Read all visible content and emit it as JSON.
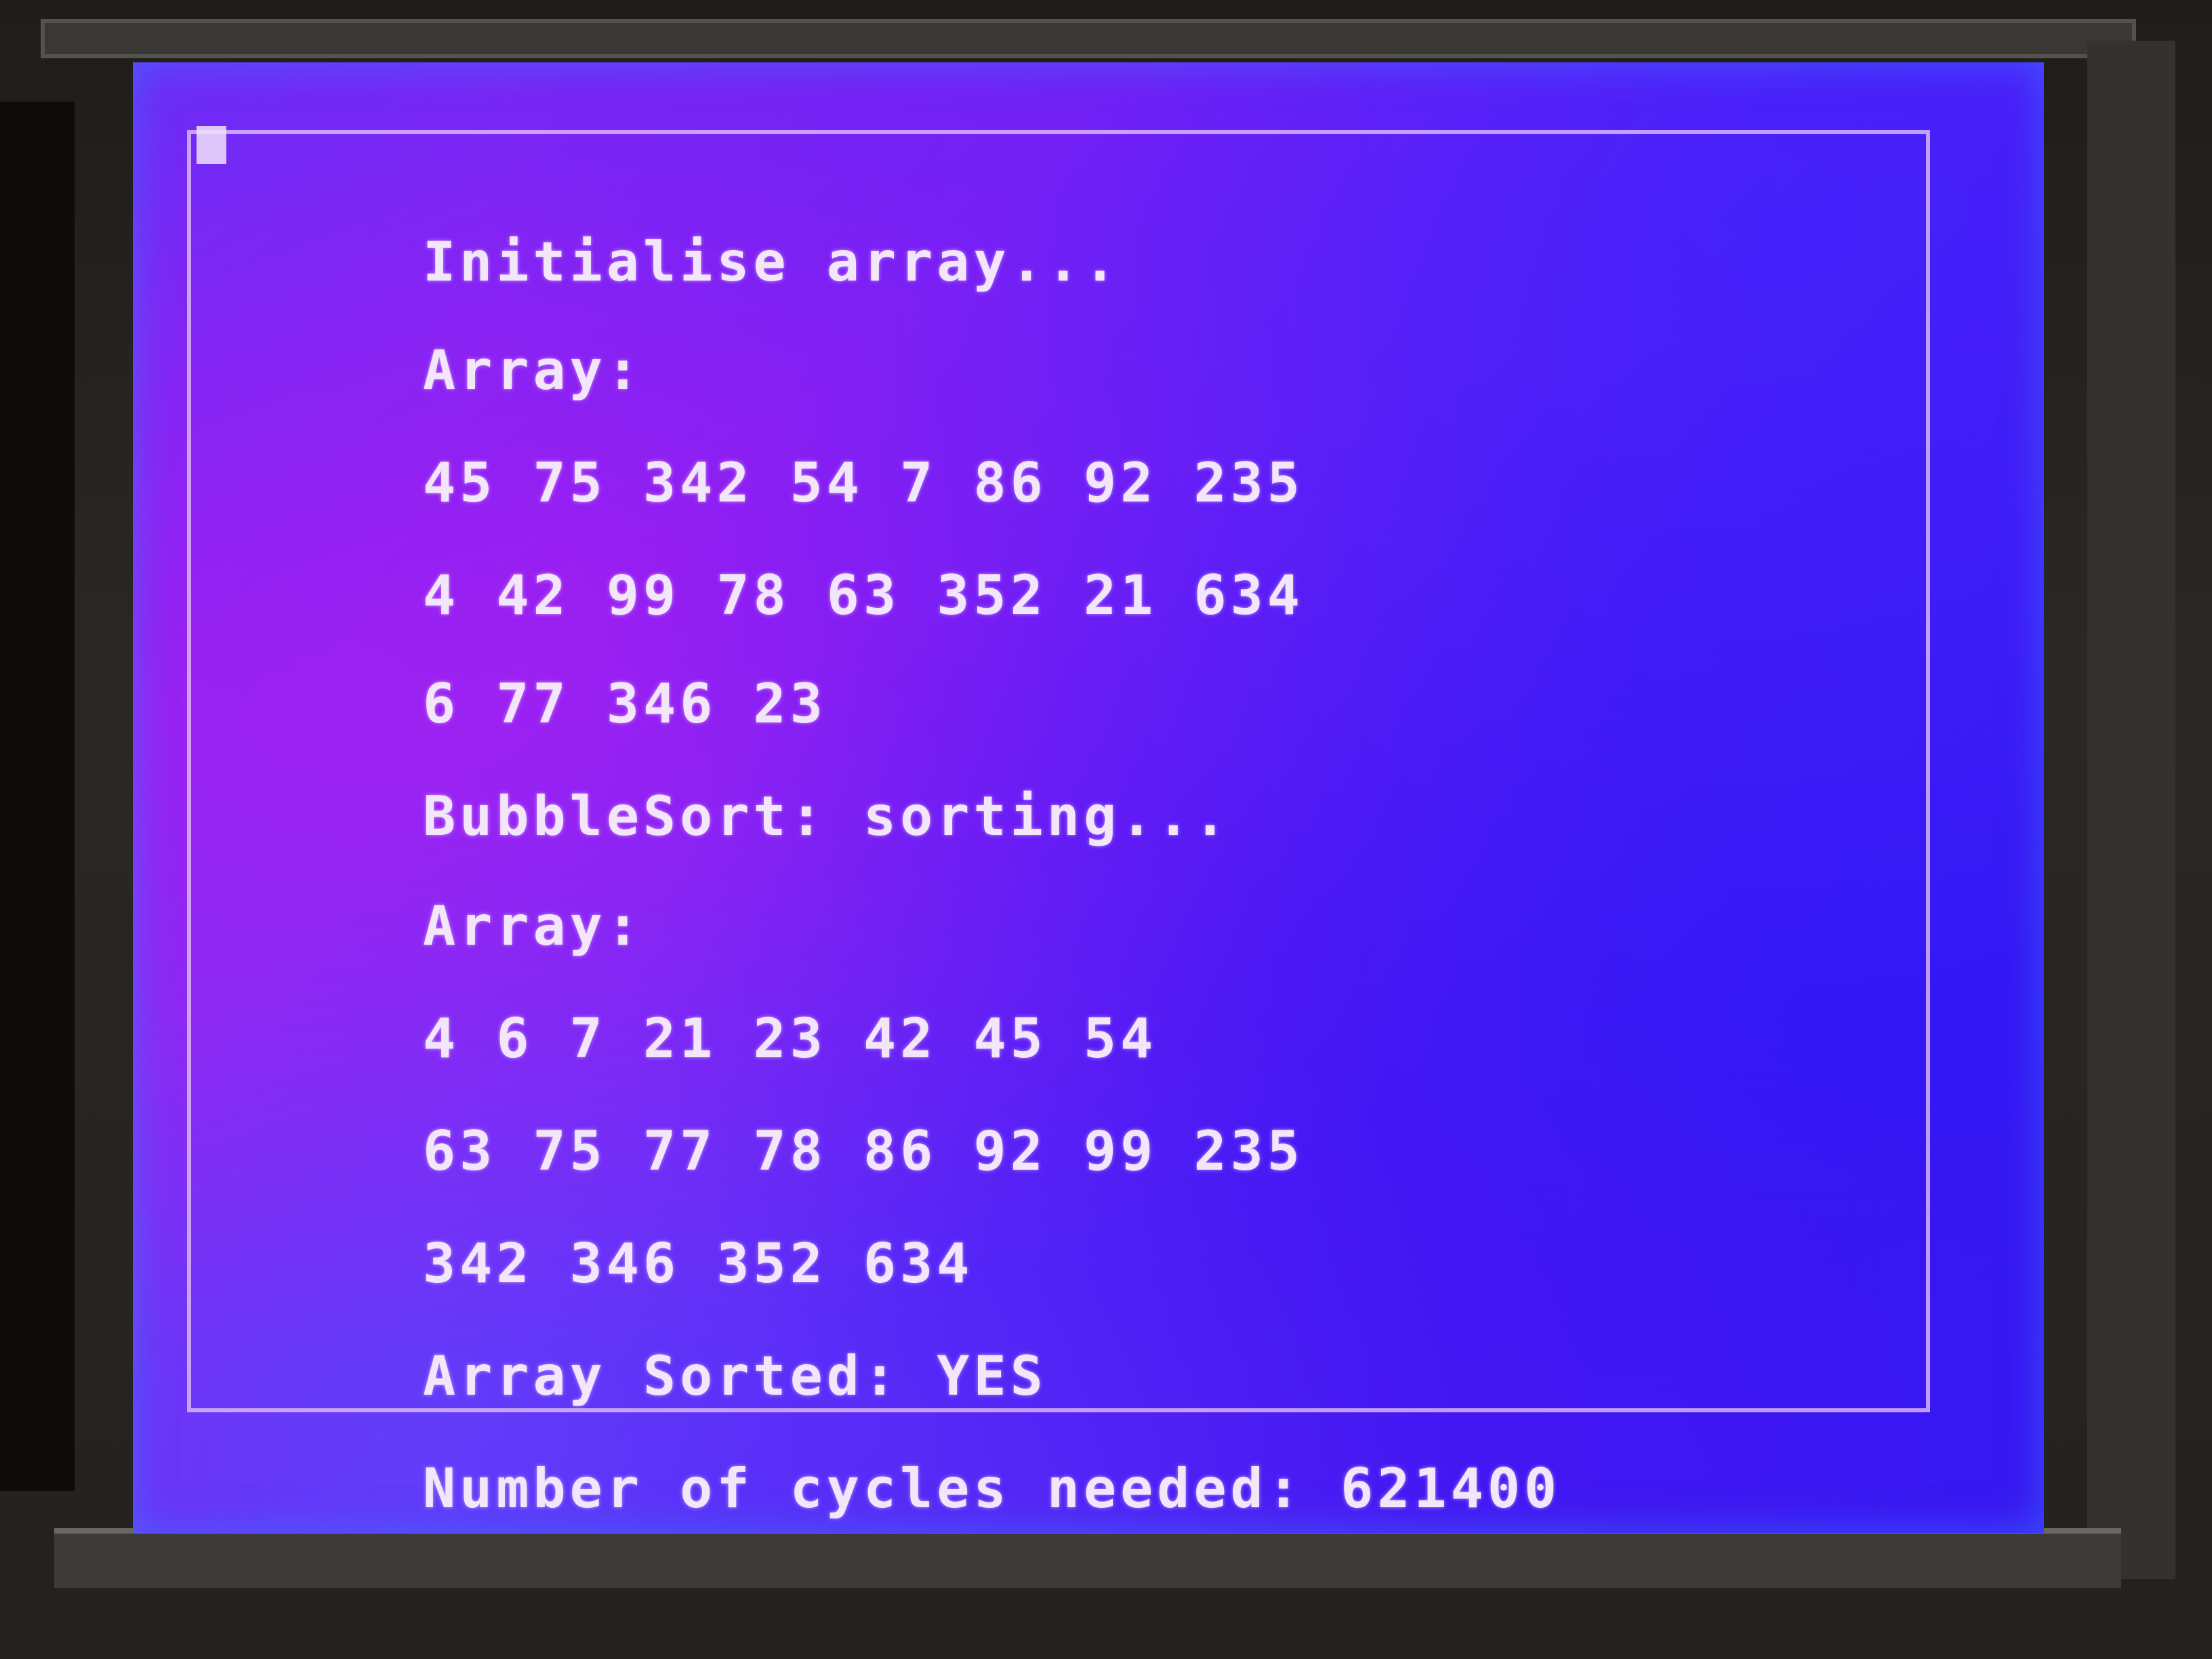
{
  "console": {
    "lines": [
      "Initialise array...",
      "Array:",
      "45 75 342 54 7 86 92 235",
      "4 42 99 78 63 352 21 634",
      "6 77 346 23",
      "BubbleSort: sorting...",
      "Array:",
      "4 6 7 21 23 42 45 54",
      "63 75 77 78 86 92 99 235",
      "342 346 352 634",
      "Array Sorted: YES",
      "Number of cycles needed: 621400"
    ]
  },
  "colors": {
    "screen_background": "#5a17f4",
    "text": "#f3e6fb",
    "border": "#e1bef5"
  }
}
